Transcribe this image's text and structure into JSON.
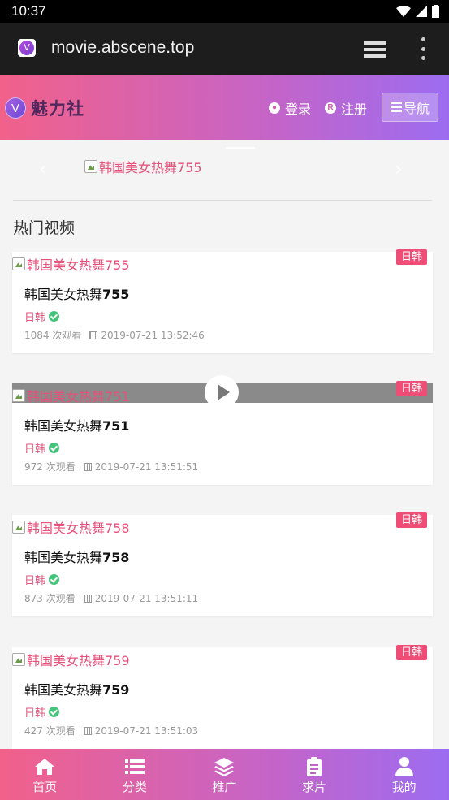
{
  "status_bar": {
    "time": "10:37"
  },
  "browser": {
    "url": "movie.abscene.top"
  },
  "header": {
    "logo_letter": "V",
    "site_name": "魅力社",
    "login_label": "登录",
    "register_label": "注册",
    "nav_label": "导航"
  },
  "slider": {
    "image_alt": "韩国美女热舞755"
  },
  "section": {
    "title": "热门视频"
  },
  "videos": [
    {
      "thumb_alt": "韩国美女热舞755",
      "badge": "日韩",
      "title_prefix": "韩国美女热舞",
      "title_num": "755",
      "category": "日韩",
      "views": "1084 次观看",
      "date": "2019-07-21 13:52:46"
    },
    {
      "thumb_alt": "韩国美女热舞751",
      "badge": "日韩",
      "title_prefix": "韩国美女热舞",
      "title_num": "751",
      "category": "日韩",
      "views": "972 次观看",
      "date": "2019-07-21 13:51:51"
    },
    {
      "thumb_alt": "韩国美女热舞758",
      "badge": "日韩",
      "title_prefix": "韩国美女热舞",
      "title_num": "758",
      "category": "日韩",
      "views": "873 次观看",
      "date": "2019-07-21 13:51:11"
    },
    {
      "thumb_alt": "韩国美女热舞759",
      "badge": "日韩",
      "title_prefix": "韩国美女热舞",
      "title_num": "759",
      "category": "日韩",
      "views": "427 次观看",
      "date": "2019-07-21 13:51:03"
    }
  ],
  "tabbar": [
    {
      "label": "首页",
      "icon": "home-icon"
    },
    {
      "label": "分类",
      "icon": "list-icon"
    },
    {
      "label": "推广",
      "icon": "layers-icon"
    },
    {
      "label": "求片",
      "icon": "clipboard-icon"
    },
    {
      "label": "我的",
      "icon": "user-icon"
    }
  ]
}
